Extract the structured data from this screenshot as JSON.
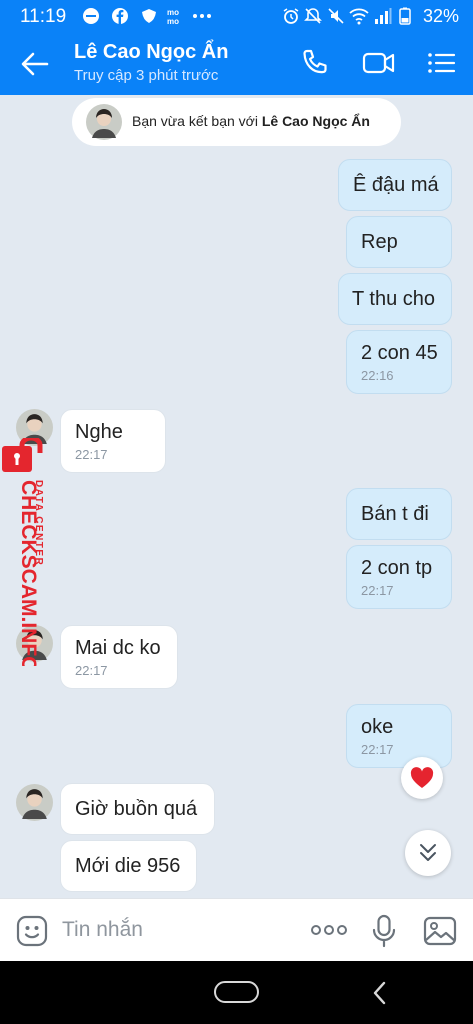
{
  "status_bar": {
    "time": "11:19",
    "battery": "32%",
    "left_icons": [
      "minus-circle-icon",
      "facebook-icon",
      "vpn-shield-icon",
      "momo-icon",
      "more-dots-icon"
    ],
    "right_icons": [
      "alarm-icon",
      "mute-icon",
      "silent-icon",
      "wifi-icon",
      "signal-icon",
      "battery-icon"
    ]
  },
  "header": {
    "name": "Lê Cao Ngọc Ẩn",
    "status": "Truy cập 3 phút trước",
    "accent": "#0a82f8"
  },
  "notice": {
    "prefix": "Bạn vừa kết bạn với",
    "name": "Lê Cao Ngọc Ẩn"
  },
  "messages": [
    {
      "dir": "out",
      "text": "Ê đậu má",
      "time": ""
    },
    {
      "dir": "out",
      "text": "Rep",
      "time": ""
    },
    {
      "dir": "out",
      "text": "T thu cho",
      "time": ""
    },
    {
      "dir": "out",
      "text": "2 con 45",
      "time": "22:16"
    },
    {
      "dir": "in",
      "text": "Nghe",
      "time": "22:17"
    },
    {
      "dir": "out",
      "text": "Bán t đi",
      "time": ""
    },
    {
      "dir": "out",
      "text": "2 con tp",
      "time": "22:17"
    },
    {
      "dir": "in",
      "text": "Mai dc ko",
      "time": "22:17"
    },
    {
      "dir": "out",
      "text": "oke",
      "time": "22:17"
    },
    {
      "dir": "in",
      "text": "Giờ buồn quá",
      "time": ""
    },
    {
      "dir": "in",
      "text": "Mới die 956",
      "time": ""
    }
  ],
  "watermark": {
    "brand": "CHECKSCAM.INFO",
    "tagline": "DATA CENTER"
  },
  "input": {
    "placeholder": "Tin nhắn"
  }
}
